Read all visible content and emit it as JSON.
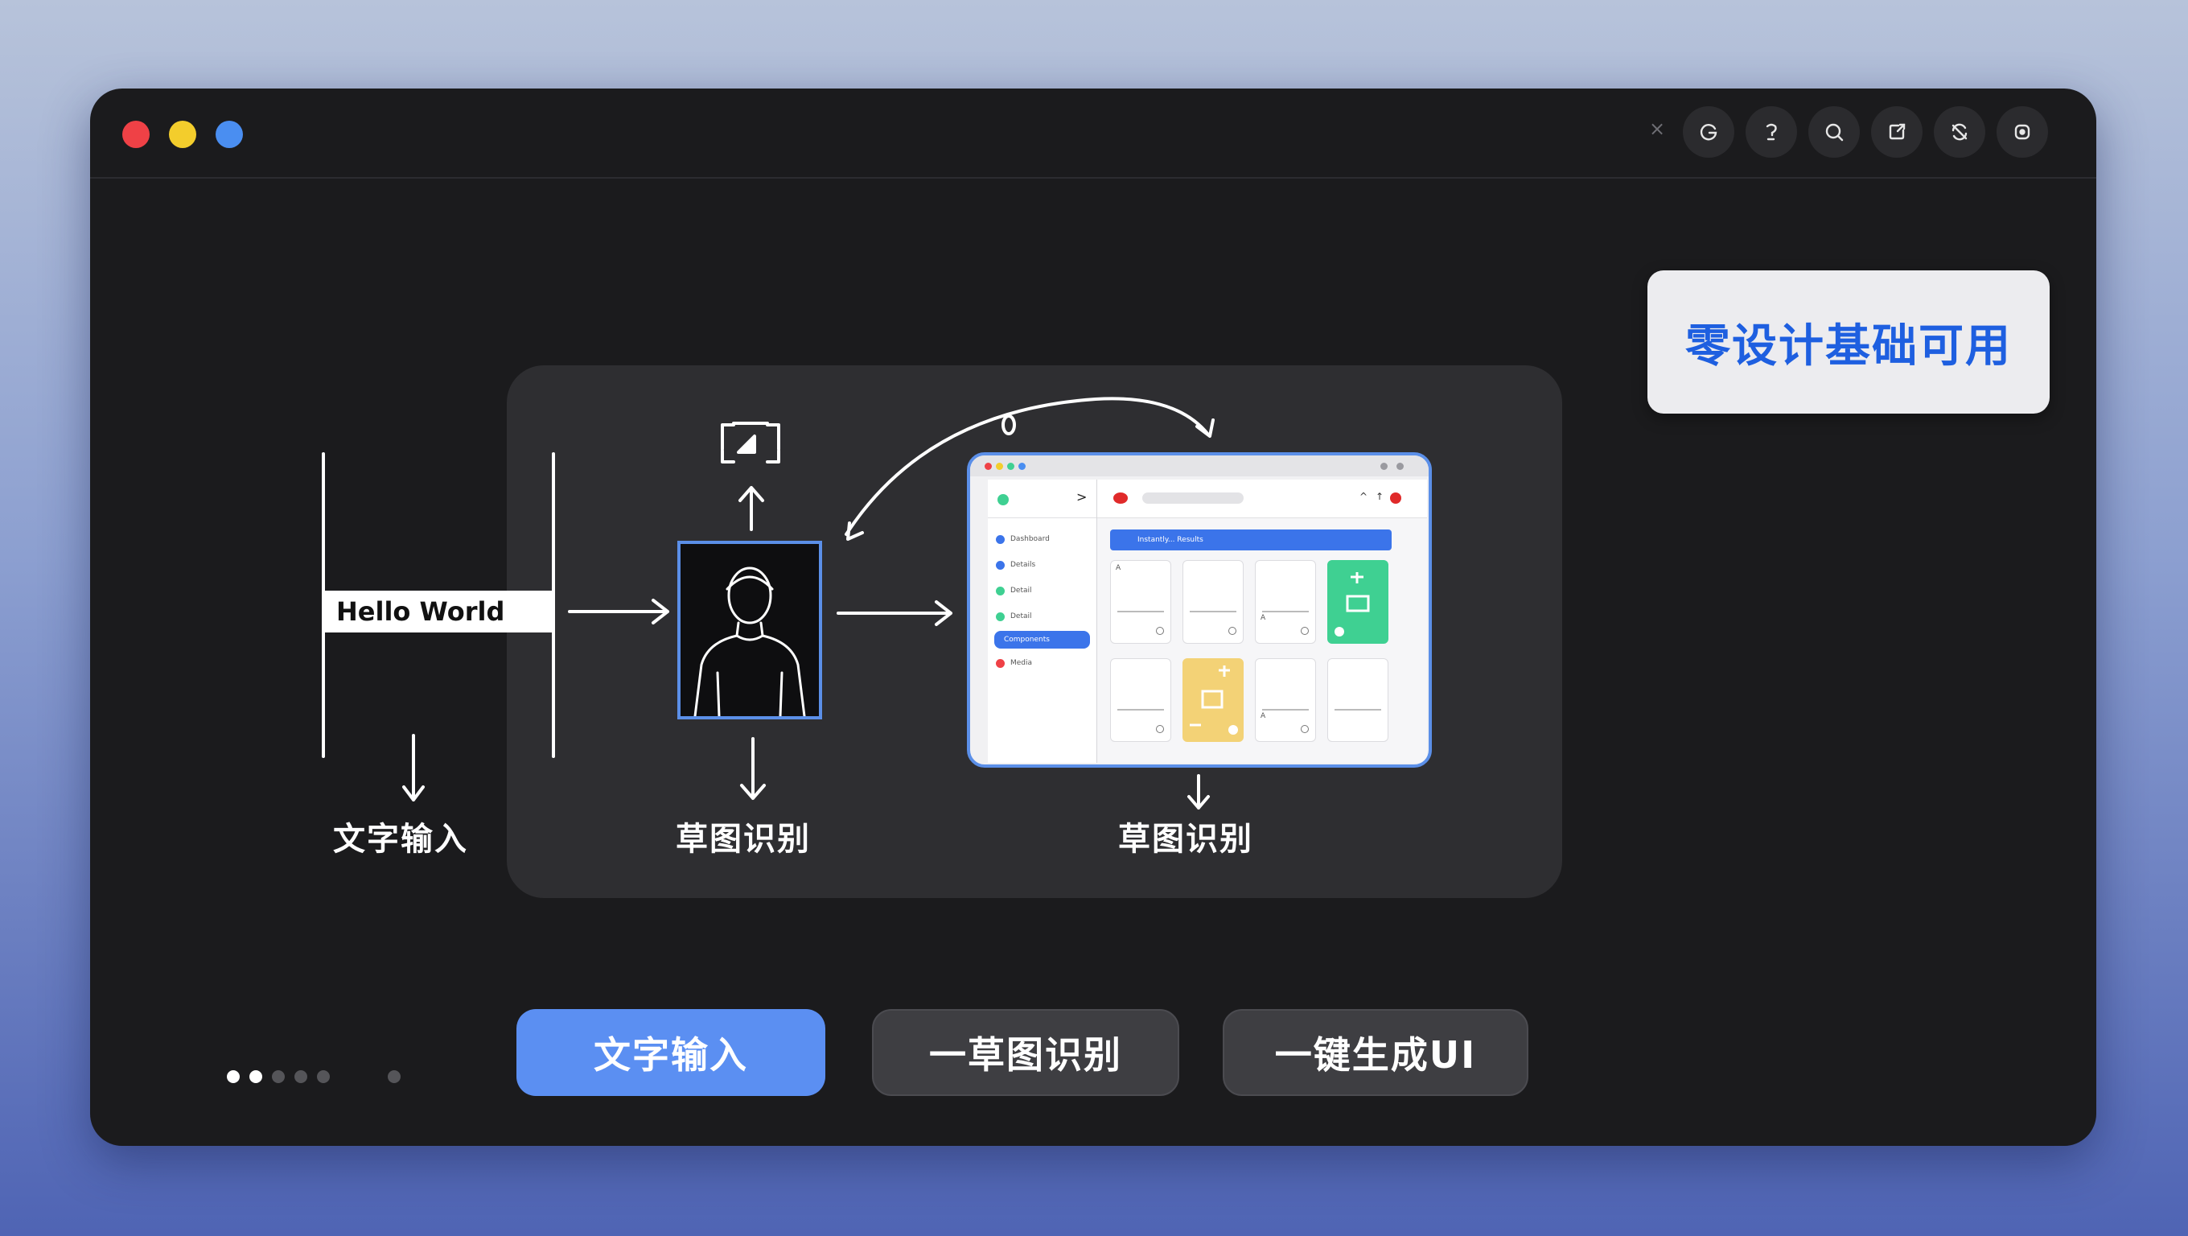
{
  "window": {
    "traffic_lights": [
      "close",
      "minimize",
      "zoom"
    ],
    "close_glyph": "×",
    "toolbar_icons": [
      "refresh-g-icon",
      "question-icon",
      "search-icon",
      "share-icon",
      "sync-icon",
      "record-icon"
    ]
  },
  "badge": {
    "text": "零设计基础可用"
  },
  "diagram": {
    "input_text": "Hello World",
    "caption_text_input": "文字输入",
    "caption_sketch_1": "草图识别",
    "caption_sketch_2": "草图识别"
  },
  "mockup": {
    "sidebar_items": [
      "Dashboard",
      "Details",
      "Detail",
      "Detail",
      "Components",
      "Media"
    ],
    "banner_text": "Instantly... Results",
    "cards": [
      "A",
      "",
      "A",
      "icon",
      "",
      "icon",
      "A",
      ""
    ]
  },
  "pager": {
    "total": 6,
    "active": [
      0,
      1
    ]
  },
  "actions": {
    "text_input": "文字输入",
    "sketch_recognition": "一草图识别",
    "one_click_generate": "一键生成UI"
  },
  "colors": {
    "accent": "#5b8ff2",
    "badge_text": "#1e5fe0",
    "dot_red": "#ef4146",
    "dot_yellow": "#f3cd2c",
    "dot_blue": "#4a8ef1"
  }
}
